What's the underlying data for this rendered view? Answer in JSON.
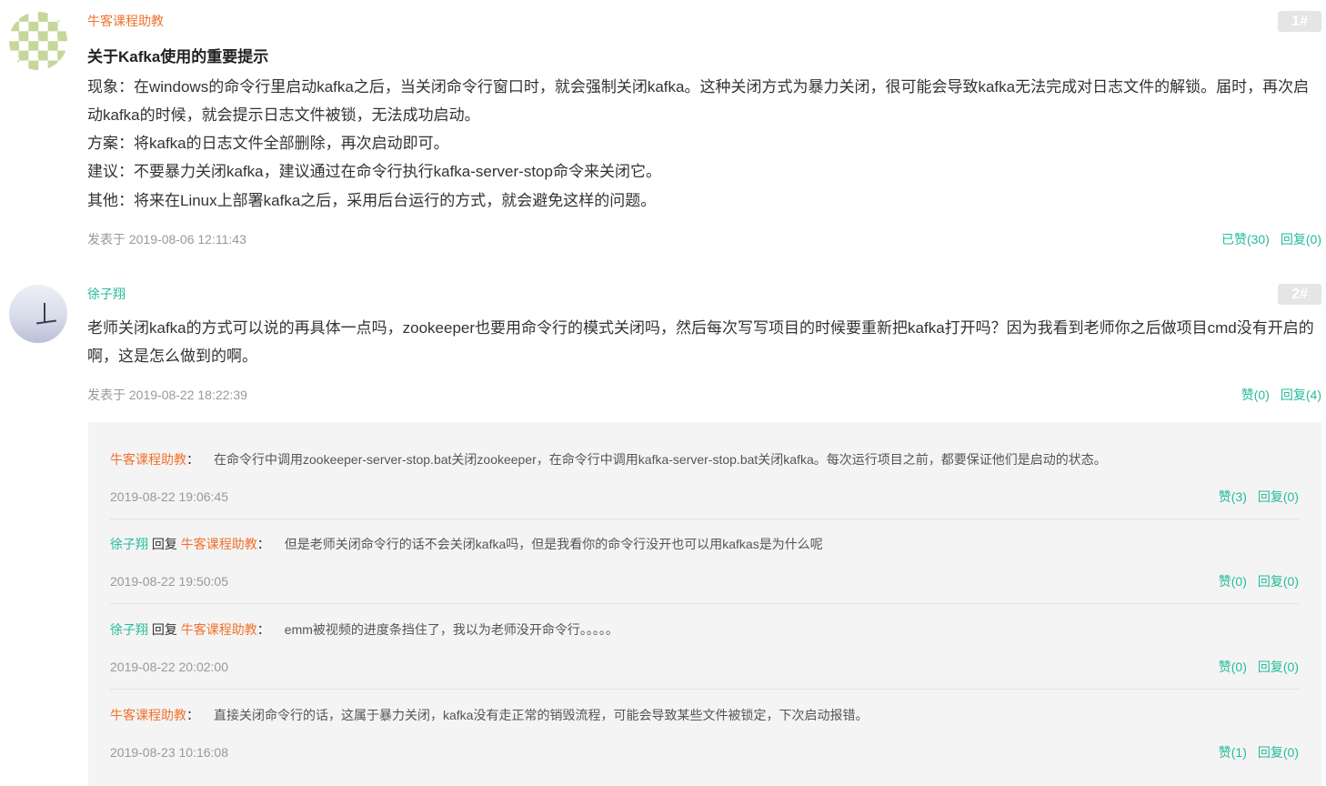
{
  "posts": [
    {
      "author": "牛客课程助教",
      "floor": "1#",
      "title": "关于Kafka使用的重要提示",
      "lines": [
        "现象：在windows的命令行里启动kafka之后，当关闭命令行窗口时，就会强制关闭kafka。这种关闭方式为暴力关闭，很可能会导致kafka无法完成对日志文件的解锁。届时，再次启动kafka的时候，就会提示日志文件被锁，无法成功启动。",
        "方案：将kafka的日志文件全部删除，再次启动即可。",
        "建议：不要暴力关闭kafka，建议通过在命令行执行kafka-server-stop命令来关闭它。",
        "其他：将来在Linux上部署kafka之后，采用后台运行的方式，就会避免这样的问题。"
      ],
      "posted_at": "发表于 2019-08-06 12:11:43",
      "like_label": "已赞(30)",
      "reply_label": "回复(0)"
    },
    {
      "author": "徐子翔",
      "floor": "2#",
      "body": "老师关闭kafka的方式可以说的再具体一点吗，zookeeper也要用命令行的模式关闭吗，然后每次写写项目的时候要重新把kafka打开吗？因为我看到老师你之后做项目cmd没有开启的啊，这是怎么做到的啊。",
      "posted_at": "发表于 2019-08-22 18:22:39",
      "like_label": "赞(0)",
      "reply_label": "回复(4)"
    }
  ],
  "replies": [
    {
      "user": "牛客课程助教",
      "reply_word": "",
      "target": "",
      "separator": "：",
      "text": "在命令行中调用zookeeper-server-stop.bat关闭zookeeper，在命令行中调用kafka-server-stop.bat关闭kafka。每次运行项目之前，都要保证他们是启动的状态。",
      "time": "2019-08-22 19:06:45",
      "like_label": "赞(3)",
      "reply_label": "回复(0)"
    },
    {
      "user": "徐子翔",
      "reply_word": " 回复 ",
      "target": "牛客课程助教",
      "separator": "：",
      "text": "但是老师关闭命令行的话不会关闭kafka吗，但是我看你的命令行没开也可以用kafkas是为什么呢",
      "time": "2019-08-22 19:50:05",
      "like_label": "赞(0)",
      "reply_label": "回复(0)"
    },
    {
      "user": "徐子翔",
      "reply_word": " 回复 ",
      "target": "牛客课程助教",
      "separator": "：",
      "text": "emm被视频的进度条挡住了，我以为老师没开命令行。。。。。",
      "time": "2019-08-22 20:02:00",
      "like_label": "赞(0)",
      "reply_label": "回复(0)"
    },
    {
      "user": "牛客课程助教",
      "reply_word": "",
      "target": "",
      "separator": "：",
      "text": "直接关闭命令行的话，这属于暴力关闭，kafka没有走正常的销毁流程，可能会导致某些文件被锁定，下次启动报错。",
      "time": "2019-08-23 10:16:08",
      "like_label": "赞(1)",
      "reply_label": "回复(0)"
    }
  ]
}
